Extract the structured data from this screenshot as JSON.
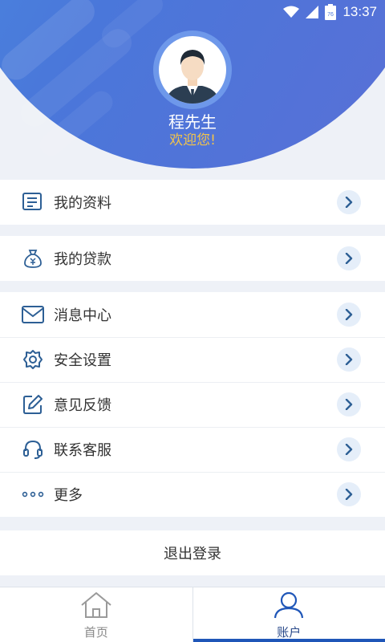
{
  "status_bar": {
    "time": "13:37",
    "battery": "76"
  },
  "profile": {
    "name": "程先生",
    "greeting": "欢迎您!"
  },
  "menu_groups": [
    [
      {
        "label": "我的资料",
        "icon": "profile-doc-icon"
      }
    ],
    [
      {
        "label": "我的贷款",
        "icon": "money-bag-icon"
      }
    ],
    [
      {
        "label": "消息中心",
        "icon": "envelope-icon"
      },
      {
        "label": "安全设置",
        "icon": "gear-icon"
      },
      {
        "label": "意见反馈",
        "icon": "edit-icon"
      },
      {
        "label": "联系客服",
        "icon": "headset-icon"
      },
      {
        "label": "更多",
        "icon": "more-dots-icon"
      }
    ]
  ],
  "logout_label": "退出登录",
  "tabs": [
    {
      "label": "首页",
      "icon": "home-icon",
      "active": false
    },
    {
      "label": "账户",
      "icon": "user-icon",
      "active": true
    }
  ],
  "colors": {
    "accent": "#1f56b8",
    "header_blue": "#4a77da",
    "greeting": "#f3c44a",
    "icon": "#2d5f95"
  }
}
